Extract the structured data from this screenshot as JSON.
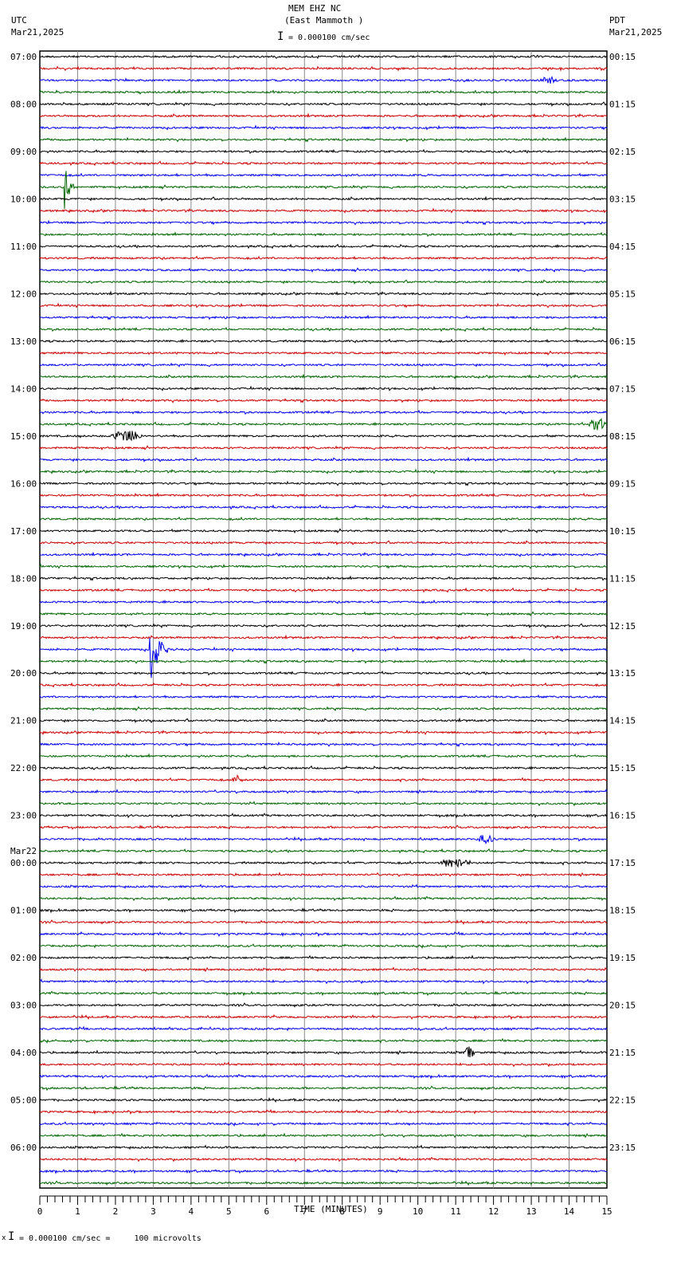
{
  "header": {
    "station": "MEM EHZ NC",
    "location": "(East Mammoth )",
    "left_tz": "UTC",
    "left_date": "Mar21,2025",
    "right_tz": "PDT",
    "right_date": "Mar21,2025",
    "scale": "= 0.000100 cm/sec"
  },
  "footer": {
    "scale": "= 0.000100 cm/sec =     100 microvolts",
    "scale_prefix": "x"
  },
  "chart_data": {
    "type": "line",
    "title": "MEM EHZ NC (East Mammoth )",
    "xlabel": "TIME (MINUTES)",
    "xlim": [
      0,
      15
    ],
    "x_ticks": [
      "0",
      "1",
      "2",
      "3",
      "4",
      "5",
      "6",
      "7",
      "8",
      "9",
      "10",
      "11",
      "12",
      "13",
      "14",
      "15"
    ],
    "traces_per_hour": 4,
    "trace_count": 96,
    "colors": [
      "#000000",
      "#cc0000",
      "#0000ee",
      "#006600"
    ],
    "left_labels": [
      {
        "trace": 0,
        "text": "07:00"
      },
      {
        "trace": 4,
        "text": "08:00"
      },
      {
        "trace": 8,
        "text": "09:00"
      },
      {
        "trace": 12,
        "text": "10:00"
      },
      {
        "trace": 16,
        "text": "11:00"
      },
      {
        "trace": 20,
        "text": "12:00"
      },
      {
        "trace": 24,
        "text": "13:00"
      },
      {
        "trace": 28,
        "text": "14:00"
      },
      {
        "trace": 32,
        "text": "15:00"
      },
      {
        "trace": 36,
        "text": "16:00"
      },
      {
        "trace": 40,
        "text": "17:00"
      },
      {
        "trace": 44,
        "text": "18:00"
      },
      {
        "trace": 48,
        "text": "19:00"
      },
      {
        "trace": 52,
        "text": "20:00"
      },
      {
        "trace": 56,
        "text": "21:00"
      },
      {
        "trace": 60,
        "text": "22:00"
      },
      {
        "trace": 64,
        "text": "23:00"
      },
      {
        "trace": 68,
        "text": "00:00",
        "date": "Mar22"
      },
      {
        "trace": 72,
        "text": "01:00"
      },
      {
        "trace": 76,
        "text": "02:00"
      },
      {
        "trace": 80,
        "text": "03:00"
      },
      {
        "trace": 84,
        "text": "04:00"
      },
      {
        "trace": 88,
        "text": "05:00"
      },
      {
        "trace": 92,
        "text": "06:00"
      }
    ],
    "right_labels": [
      "00:15",
      "01:15",
      "02:15",
      "03:15",
      "04:15",
      "05:15",
      "06:15",
      "07:15",
      "08:15",
      "09:15",
      "10:15",
      "11:15",
      "12:15",
      "13:15",
      "14:15",
      "15:15",
      "16:15",
      "17:15",
      "18:15",
      "19:15",
      "20:15",
      "21:15",
      "22:15",
      "23:15"
    ],
    "events": [
      {
        "trace": 11,
        "minute": 0.65,
        "amplitude": 30,
        "duration": 0.8,
        "spike": true
      },
      {
        "trace": 31,
        "minute": 14.5,
        "amplitude": 9,
        "duration": 0.5
      },
      {
        "trace": 32,
        "minute": 1.8,
        "amplitude": 8,
        "duration": 1.0
      },
      {
        "trace": 50,
        "minute": 2.9,
        "amplitude": 60,
        "duration": 1.0,
        "spike": true
      },
      {
        "trace": 68,
        "minute": 10.5,
        "amplitude": 6,
        "duration": 1.0
      },
      {
        "trace": 84,
        "minute": 11.2,
        "amplitude": 8,
        "duration": 0.3
      },
      {
        "trace": 61,
        "minute": 5.1,
        "amplitude": 7,
        "duration": 0.2
      },
      {
        "trace": 66,
        "minute": 11.5,
        "amplitude": 6,
        "duration": 0.6
      },
      {
        "trace": 2,
        "minute": 13.2,
        "amplitude": 5,
        "duration": 0.5
      }
    ]
  }
}
